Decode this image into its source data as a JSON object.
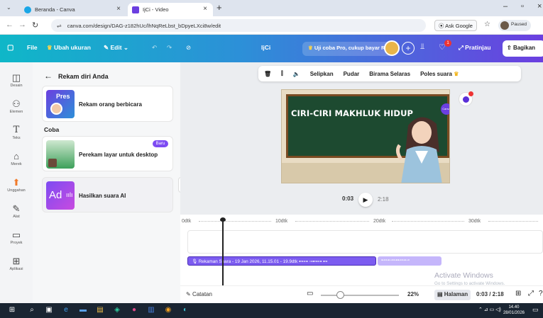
{
  "browser": {
    "tabs": [
      {
        "title": "Beranda - Canva",
        "favicon_color": "#1aa6e6"
      },
      {
        "title": "IjCi - Video",
        "favicon_color": "#6b3fe0"
      }
    ],
    "url": "canva.com/design/DAG-z182hUc/lhNqReLbst_bDpyeLXci8w/edit",
    "ask_google": "Ask Google",
    "profile_status": "Paused"
  },
  "canva_bar": {
    "file": "File",
    "resize": "Ubah ukuran",
    "edit": "Edit",
    "design_name": "IjCi",
    "trial": "Uji coba Pro, cukup bayar Rp0",
    "notification_count": "1",
    "preview": "Pratinjau",
    "share": "Bagikan"
  },
  "rail": {
    "items": [
      {
        "label": "Desain",
        "icon": "layout-icon"
      },
      {
        "label": "Elemen",
        "icon": "shapes-icon"
      },
      {
        "label": "Teks",
        "icon": "text-icon"
      },
      {
        "label": "Merek",
        "icon": "brand-icon"
      },
      {
        "label": "Unggahan",
        "icon": "upload-icon"
      },
      {
        "label": "Alat",
        "icon": "draw-icon"
      },
      {
        "label": "Proyek",
        "icon": "folder-icon"
      },
      {
        "label": "Aplikasi",
        "icon": "apps-icon"
      }
    ]
  },
  "panel": {
    "title": "Rekam diri Anda",
    "card1_label": "Rekam orang berbicara",
    "card1_thumb_text": "Pres",
    "section": "Coba",
    "card2_label": "Perekam layar untuk desktop",
    "card2_badge": "Baru",
    "card3_label": "Hasilkan suara AI",
    "card3_thumb_text": "Ad"
  },
  "toolbar": {
    "insert": "Selipkan",
    "fade": "Pudar",
    "beat_sync": "Birama Selaras",
    "enhance": "Poles suara"
  },
  "slide": {
    "title": "CIRI-CIRI MAKHLUK HIDUP",
    "badge": "Canva"
  },
  "player": {
    "current": "0:03",
    "total": "2:18"
  },
  "timeline": {
    "ticks": [
      "0dtk",
      "10dtk",
      "20dtk",
      "30dtk"
    ],
    "audio_clip": "Rekaman Suara - 19 Jan 2026, 11.15.01 - 19.9dtk"
  },
  "watermark": {
    "title": "Activate Windows",
    "subtitle": "Go to Settings to activate Windows."
  },
  "footer": {
    "notes": "Catatan",
    "zoom": "22%",
    "zoom_level": 0.22,
    "pages": "Halaman",
    "time": "0:03 / 2:18"
  },
  "taskbar": {
    "time": "14.40",
    "date": "28/01/2026"
  }
}
